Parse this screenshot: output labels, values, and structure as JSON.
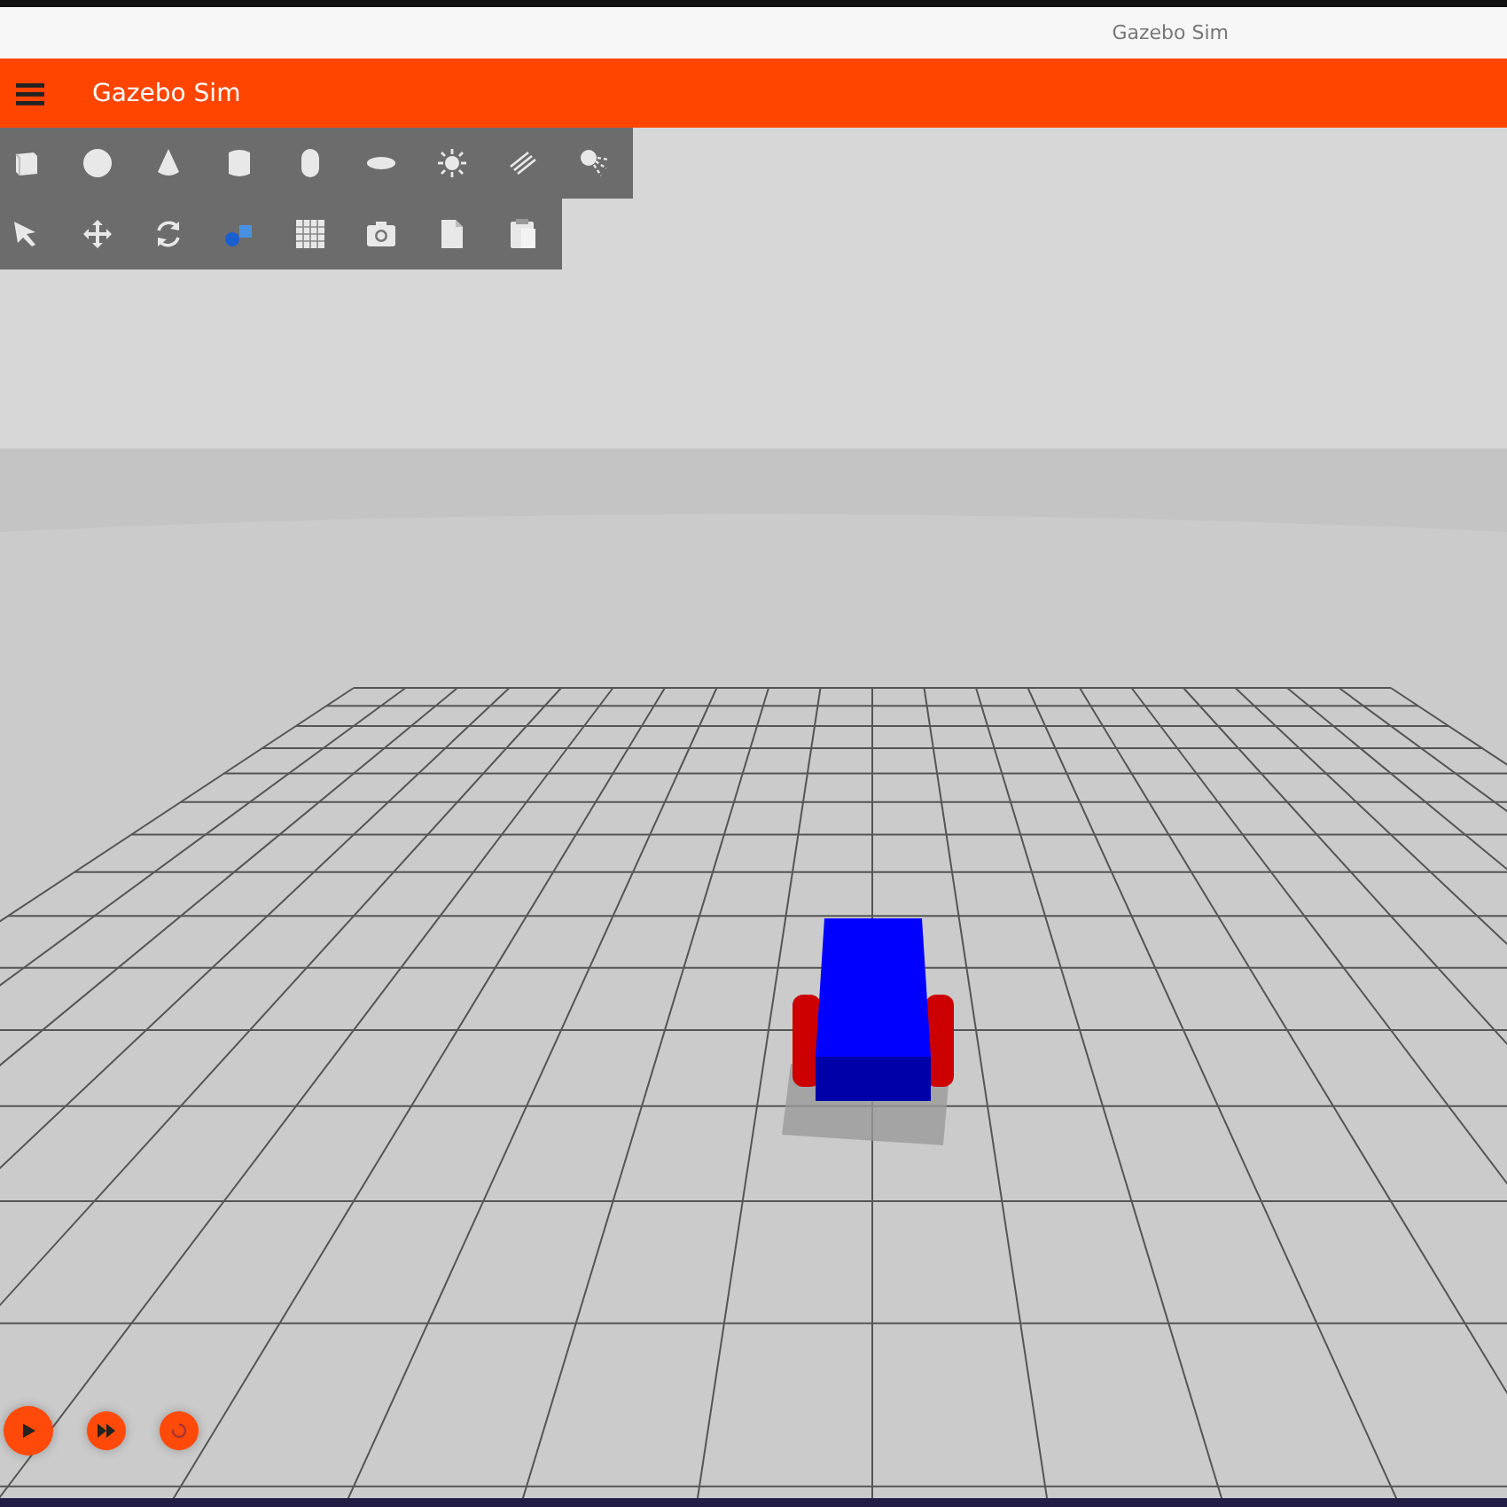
{
  "window": {
    "title": "Gazebo Sim"
  },
  "app_bar": {
    "title": "Gazebo Sim"
  }
}
